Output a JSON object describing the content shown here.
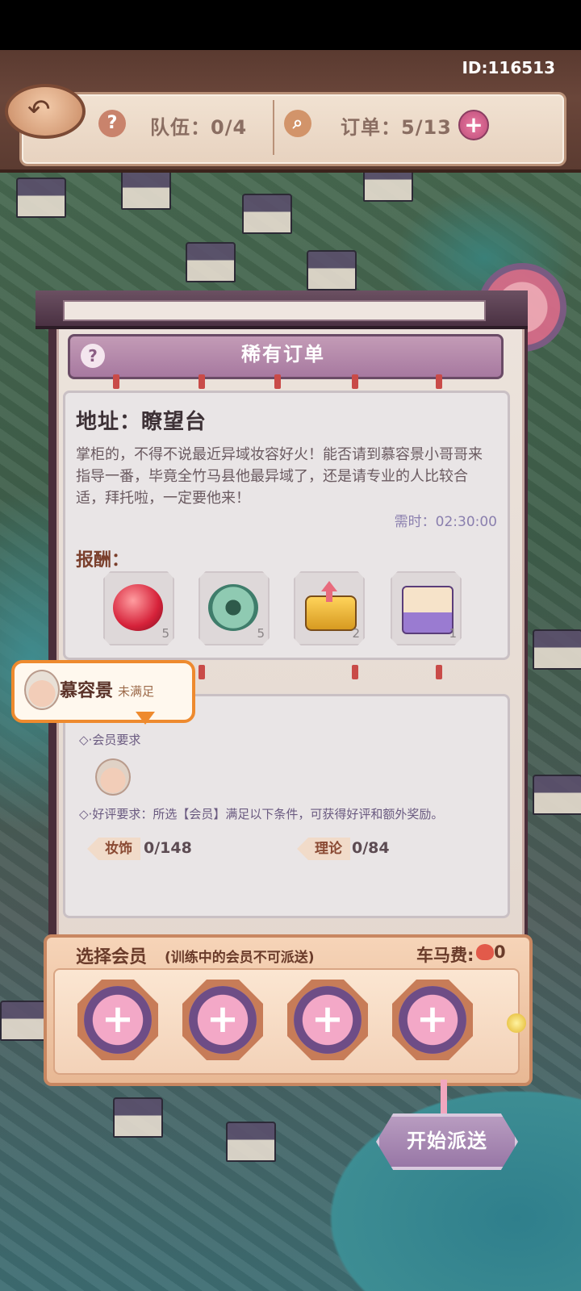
{
  "header": {
    "player_id": "ID:116513",
    "team_label": "队伍：0/4",
    "order_label": "订单：5/13",
    "team_icon": "question-mark-icon",
    "order_icon": "magnifier-icon",
    "add_order_icon": "plus-icon",
    "back_icon": "back-arrow-icon"
  },
  "panel": {
    "title": "稀有订单",
    "help_glyph": "?",
    "address": "地址：瞭望台",
    "description": "掌柜的，不得不说最近异域妆容好火！能否请到慕容景小哥哥来指导一番，毕竟全竹马县他最异域了，还是请专业的人比较合适，拜托啦，一定要他来！",
    "time_required": "需时：02:30:00",
    "reward_label": "报酬：",
    "rewards": [
      {
        "icon": "red-orb-icon",
        "count": "5"
      },
      {
        "icon": "green-jade-ring-icon",
        "count": "5"
      },
      {
        "icon": "gold-upgrade-chest-icon",
        "count": "2"
      },
      {
        "icon": "cat-mystery-box-icon",
        "count": "1"
      }
    ]
  },
  "tooltip": {
    "name": "慕容景",
    "status": "未满足"
  },
  "requirements": {
    "member_req_label": "会员要求",
    "review_req_text": "好评要求：所选【会员】满足以下条件，可获得好评和额外奖励。",
    "stats": [
      {
        "label": "妆饰",
        "value": "0/148"
      },
      {
        "label": "理论",
        "value": "0/84"
      }
    ]
  },
  "select": {
    "title": "选择会员",
    "note": "(训练中的会员不可派送)",
    "fee_label": "车马费:",
    "fee_value": "0",
    "slot_plus": "+"
  },
  "start_button": "开始派送",
  "colors": {
    "accent_purple": "#a779a0",
    "tooltip_orange": "#ee8a2e",
    "panel_bg": "#ece3dc"
  }
}
